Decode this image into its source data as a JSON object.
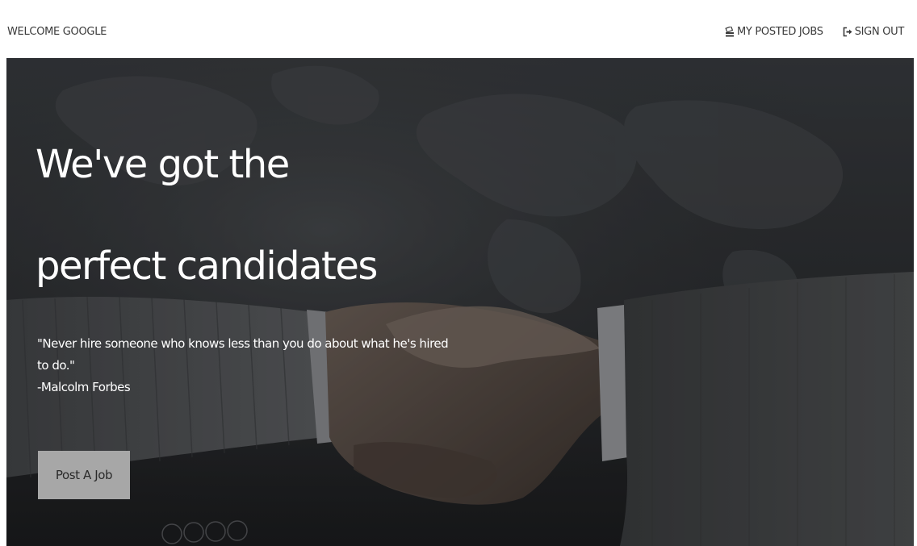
{
  "nav": {
    "brand": "WELCOME GOOGLE",
    "my_jobs": {
      "label": "MY POSTED JOBS",
      "icon": "stack-icon"
    },
    "sign_out": {
      "label": "SIGN OUT",
      "icon": "sign-out-icon"
    }
  },
  "hero": {
    "headline_line1": "We've got the",
    "headline_line2": "perfect candidates",
    "quote_text": "\"Never hire someone who knows less than you do about what he's hired to do.\"",
    "quote_author": "-Malcolm Forbes",
    "cta_label": "Post A Job"
  },
  "colors": {
    "navbar_bg": "#ffffff",
    "nav_text": "#3a3a3a",
    "hero_overlay": "#2b2d30",
    "cta_bg": "#a7a7a7",
    "hero_text": "#ffffff"
  }
}
